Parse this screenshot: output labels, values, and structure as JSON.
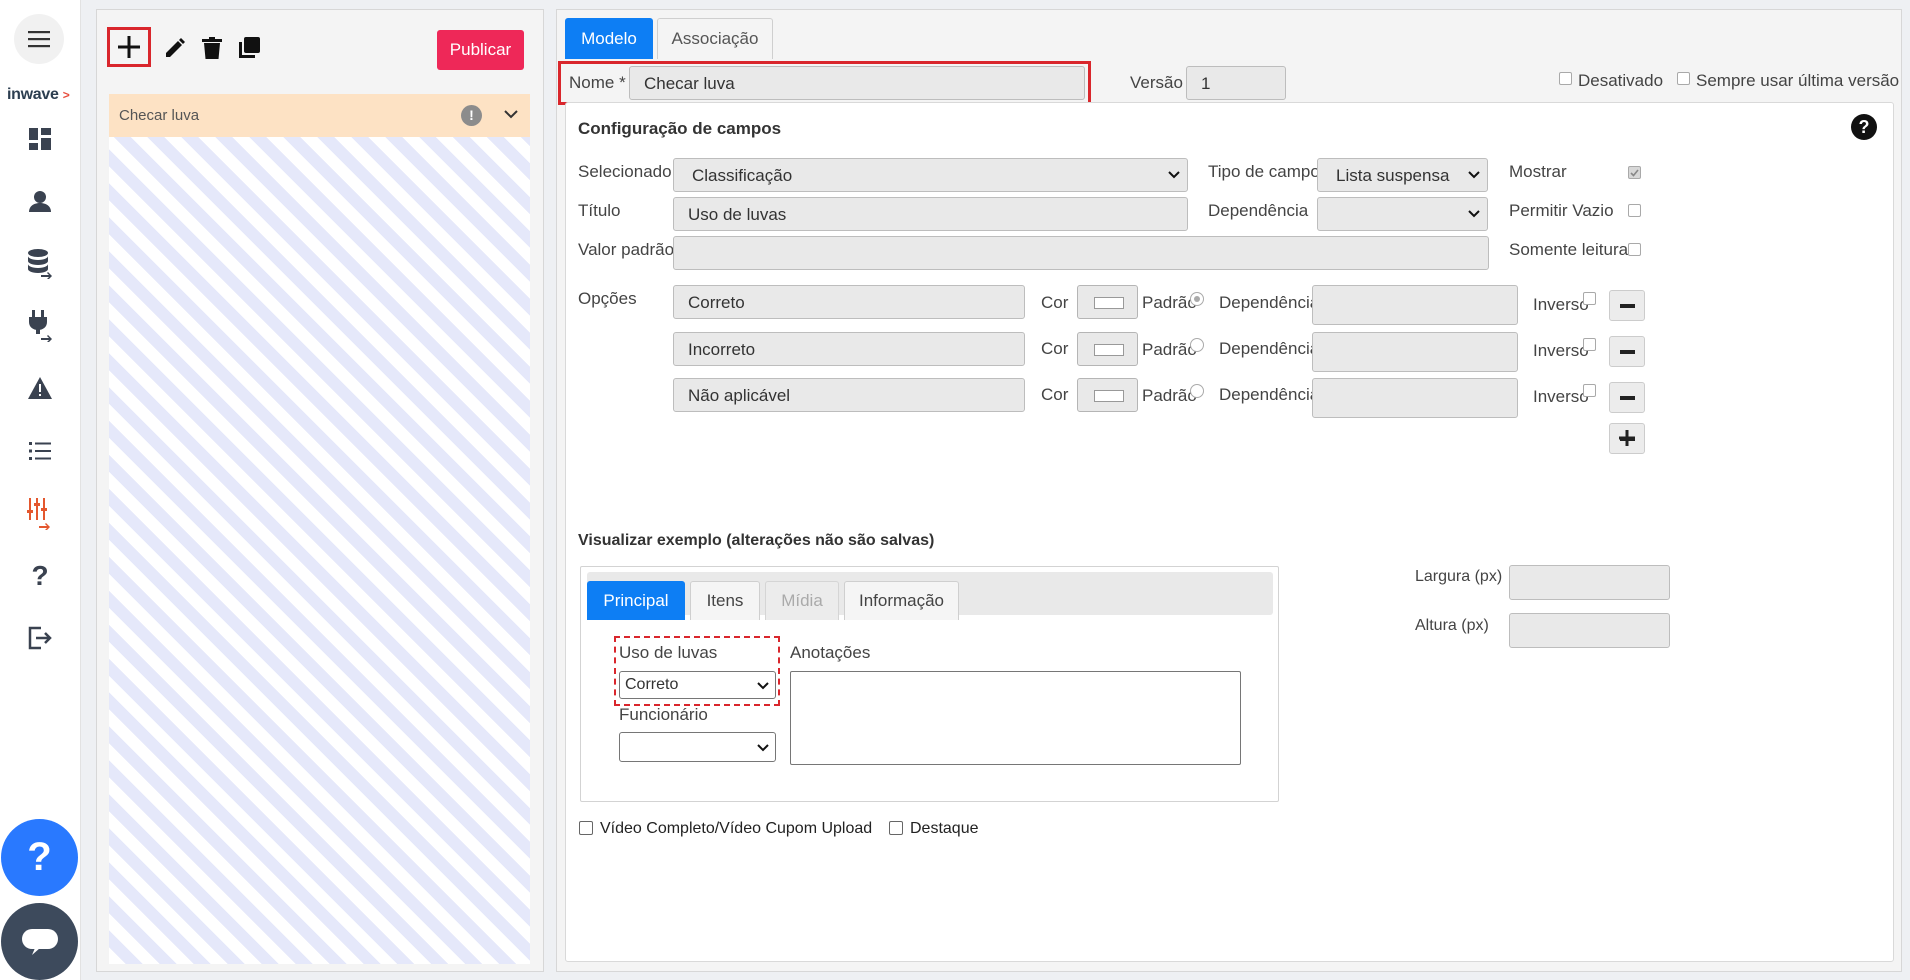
{
  "nav": {
    "logo_text": "inwave",
    "logo_mark": ">",
    "help_symbol": "?"
  },
  "left": {
    "publish_label": "Publicar",
    "tree_item": "Checar luva",
    "tree_warning": "!"
  },
  "right": {
    "tabs": [
      "Modelo",
      "Associação"
    ],
    "name_label": "Nome *",
    "name_value": "Checar luva",
    "version_label": "Versão",
    "version_value": "1",
    "disabled_label": "Desativado",
    "latest_label": "Sempre usar última versão"
  },
  "config": {
    "title": "Configuração de campos",
    "selected_label": "Selecionado",
    "selected_value": "Classificação",
    "field_type_label": "Tipo de campo",
    "field_type_value": "Lista suspensa",
    "show_label": "Mostrar",
    "title_label": "Título",
    "title_value": "Uso de luvas",
    "dependency_label": "Dependência",
    "allow_empty_label": "Permitir Vazio",
    "default_label": "Valor padrão",
    "readonly_label": "Somente leitura",
    "options_label": "Opções",
    "options": [
      {
        "value": "Correto",
        "cor": "Cor",
        "padrao": "Padrão",
        "dep": "Dependência",
        "inverso": "Inverso"
      },
      {
        "value": "Incorreto",
        "cor": "Cor",
        "padrao": "Padrão",
        "dep": "Dependência",
        "inverso": "Inverso"
      },
      {
        "value": "Não aplicável",
        "cor": "Cor",
        "padrao": "Padrão",
        "dep": "Dependência",
        "inverso": "Inverso"
      }
    ]
  },
  "preview": {
    "title": "Visualizar exemplo (alterações não são salvas)",
    "tabs": [
      "Principal",
      "Itens",
      "Mídia",
      "Informação"
    ],
    "field_label": "Uso de luvas",
    "field_value": "Correto",
    "employee_label": "Funcionário",
    "notes_label": "Anotações",
    "width_label": "Largura (px)",
    "height_label": "Altura (px)",
    "video_label": "Vídeo Completo/Vídeo Cupom Upload",
    "highlight_label": "Destaque"
  }
}
